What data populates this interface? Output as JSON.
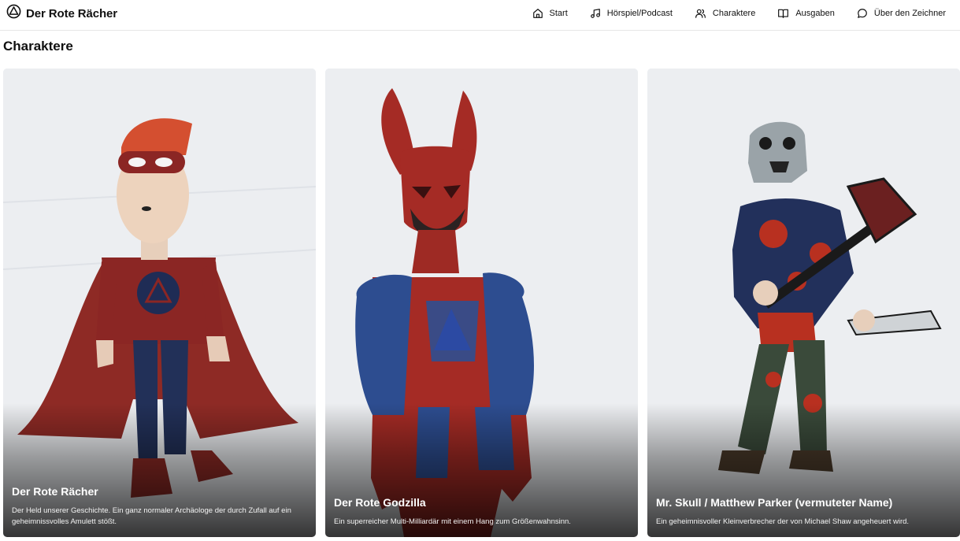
{
  "header": {
    "brand": "Der Rote Rächer",
    "nav": [
      {
        "label": "Start",
        "icon": "home-icon"
      },
      {
        "label": "Hörspiel/Podcast",
        "icon": "music-note-icon"
      },
      {
        "label": "Charaktere",
        "icon": "users-icon"
      },
      {
        "label": "Ausgaben",
        "icon": "book-icon"
      },
      {
        "label": "Über den Zeichner",
        "icon": "chat-bubble-icon"
      }
    ]
  },
  "page": {
    "title": "Charaktere"
  },
  "characters": [
    {
      "name": "Der Rote Rächer",
      "description": "Der Held unserer Geschichte. Ein ganz normaler Archäologe der durch Zufall auf ein geheimnissvolles Amulett stößt.",
      "image": "red-hero-drawing"
    },
    {
      "name": "Der Rote Godzilla",
      "description": "Ein superreicher Multi-Milliardär mit einem Hang zum Größenwahnsinn.",
      "image": "red-horned-villain-drawing"
    },
    {
      "name": "Mr. Skull / Matthew Parker (vermuteter Name)",
      "description": "Ein geheimnisvoller Kleinverbrecher der von Michael Shaw angeheuert wird.",
      "image": "skull-mask-axe-drawing"
    }
  ],
  "colors": {
    "hero_red": "#9b2a24",
    "navy": "#1f2c55",
    "paper": "#eceef1"
  }
}
